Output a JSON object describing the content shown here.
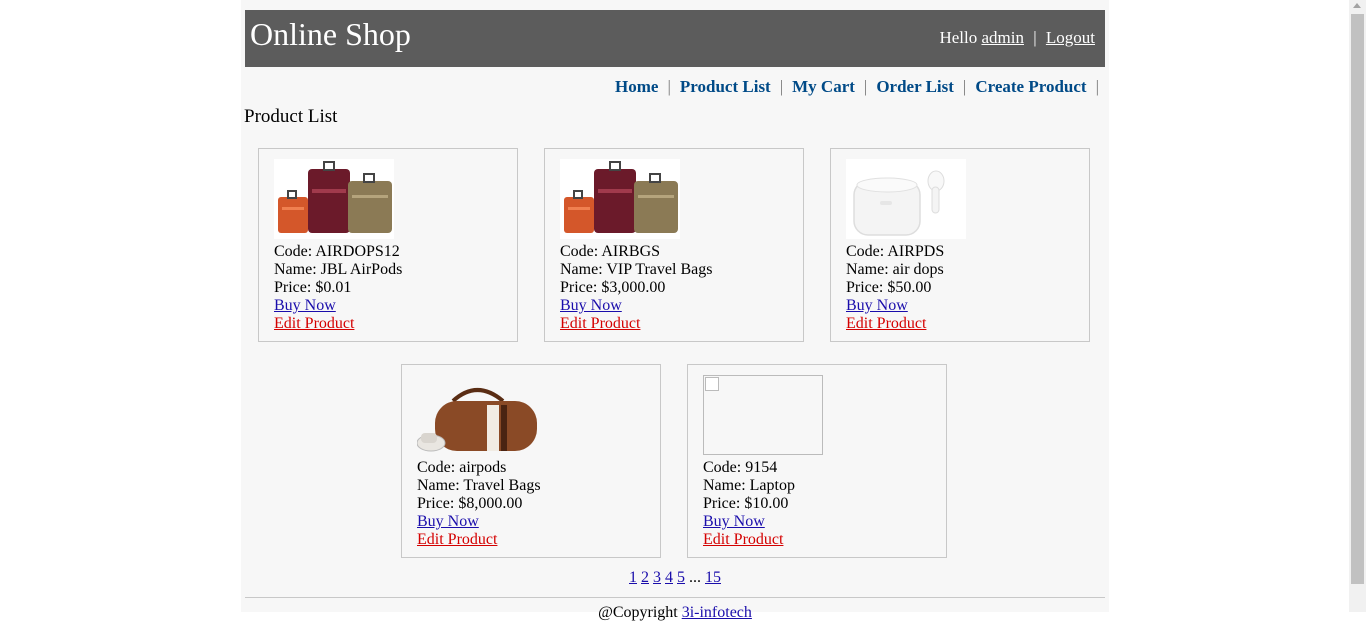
{
  "header": {
    "title": "Online Shop",
    "greeting": "Hello",
    "username": "admin",
    "logout": "Logout"
  },
  "menu": {
    "home": "Home",
    "product_list": "Product List",
    "my_cart": "My Cart",
    "order_list": "Order List",
    "create_product": "Create Product"
  },
  "page_title": "Product List",
  "products": [
    {
      "code": "Code: AIRDOPS12",
      "name": "Name: JBL AirPods",
      "price": "Price: $0.01",
      "buy": "Buy Now",
      "edit": "Edit Product",
      "image": "luggage-set-icon"
    },
    {
      "code": "Code: AIRBGS",
      "name": "Name: VIP Travel Bags",
      "price": "Price: $3,000.00",
      "buy": "Buy Now",
      "edit": "Edit Product",
      "image": "luggage-set-icon"
    },
    {
      "code": "Code: AIRPDS",
      "name": "Name: air dops",
      "price": "Price: $50.00",
      "buy": "Buy Now",
      "edit": "Edit Product",
      "image": "airpods-icon"
    },
    {
      "code": "Code: airpods",
      "name": "Name: Travel Bags",
      "price": "Price: $8,000.00",
      "buy": "Buy Now",
      "edit": "Edit Product",
      "image": "duffel-bag-icon"
    },
    {
      "code": "Code: 9154",
      "name": "Name: Laptop",
      "price": "Price: $10.00",
      "buy": "Buy Now",
      "edit": "Edit Product",
      "image": "broken-image-icon"
    }
  ],
  "pagination": {
    "pages": [
      "1",
      "2",
      "3",
      "4",
      "5"
    ],
    "ellipsis": "...",
    "last": "15"
  },
  "footer": {
    "copyright": "@Copyright",
    "link": "3i-infotech"
  },
  "colors": {
    "header_bg": "#5c5c5c",
    "menu_link": "#004a87",
    "edit_link": "#d40000",
    "buy_link": "#1a0dab"
  }
}
